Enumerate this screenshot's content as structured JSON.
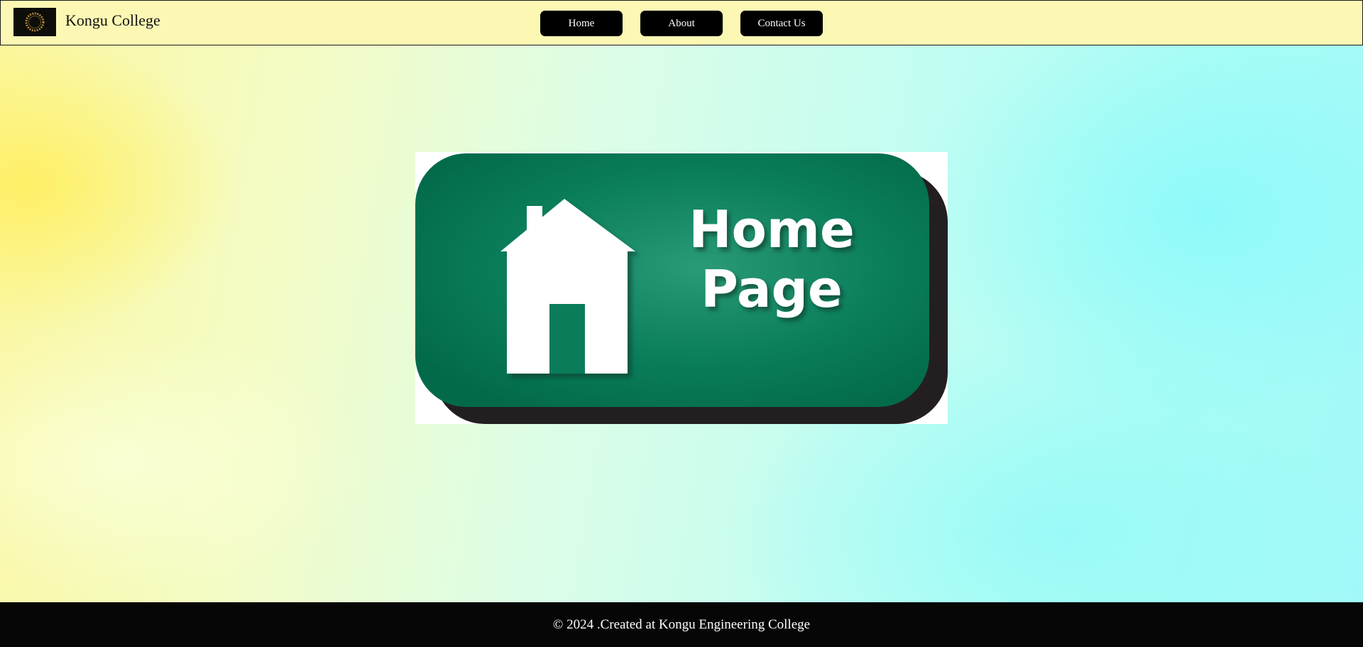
{
  "header": {
    "logo_icon": "laurel-wreath-icon",
    "brand": "Kongu College",
    "nav": [
      {
        "label": "Home"
      },
      {
        "label": "About"
      },
      {
        "label": "Contact Us"
      }
    ]
  },
  "hero": {
    "image_name": "home-page-button-image",
    "line1": "Home",
    "line2": "Page",
    "colors": {
      "green": "#047a57",
      "shadow": "#231f20"
    }
  },
  "footer": {
    "text": "© 2024 .Created at Kongu Engineering College"
  }
}
